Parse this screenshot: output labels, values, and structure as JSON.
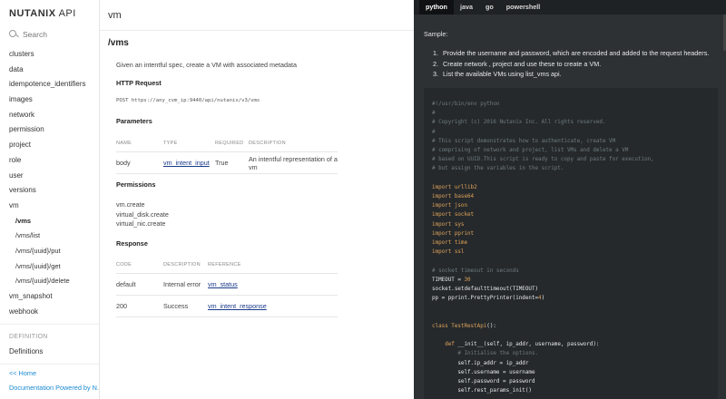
{
  "logo": {
    "brand": "NUTANIX",
    "api": "API"
  },
  "search": {
    "placeholder": "Search"
  },
  "sidebar": {
    "items": [
      {
        "label": "clusters"
      },
      {
        "label": "data"
      },
      {
        "label": "idempotence_identifiers"
      },
      {
        "label": "images"
      },
      {
        "label": "network"
      },
      {
        "label": "permission"
      },
      {
        "label": "project"
      },
      {
        "label": "role"
      },
      {
        "label": "user"
      },
      {
        "label": "versions"
      },
      {
        "label": "vm"
      }
    ],
    "vm_sub": [
      {
        "label": "/vms"
      },
      {
        "label": "/vms/list"
      },
      {
        "label": "/vms/{uuid}/put"
      },
      {
        "label": "/vms/{uuid}/get"
      },
      {
        "label": "/vms/{uuid}/delete"
      }
    ],
    "after_items": [
      {
        "label": "vm_snapshot"
      },
      {
        "label": "webhook"
      }
    ],
    "definition_header": "DEFINITION",
    "definitions_label": "Definitions",
    "home_link": "<< Home",
    "powered_by": "Documentation Powered by N..."
  },
  "content": {
    "title": "vm",
    "path": "/vms",
    "description": "Given an intentful spec, create a VM with associated metadata",
    "http_request_heading": "HTTP Request",
    "http_request_code": "POST https://any_cvm_ip:9440/api/nutanix/v3/vms",
    "parameters_heading": "Parameters",
    "param_headers": [
      "NAME",
      "TYPE",
      "REQUIRED",
      "DESCRIPTION"
    ],
    "params": [
      {
        "name": "body",
        "type": "vm_intent_input",
        "required": "True",
        "description": "An intentful representation of a vm"
      }
    ],
    "permissions_heading": "Permissions",
    "permissions": [
      "vm.create",
      "virtual_disk.create",
      "virtual_nic.create"
    ],
    "response_heading": "Response",
    "response_headers": [
      "CODE",
      "DESCRIPTION",
      "REFERENCE"
    ],
    "responses": [
      {
        "code": "default",
        "description": "Internal error",
        "reference": "vm_status"
      },
      {
        "code": "200",
        "description": "Success",
        "reference": "vm_intent_response"
      }
    ]
  },
  "code_panel": {
    "tabs": [
      "python",
      "java",
      "go",
      "powershell"
    ],
    "active_tab": "python",
    "sample_label": "Sample:",
    "steps": [
      "Provide the username and password, which are encoded and added to the request headers.",
      "Create network , project and use these to create a VM.",
      "List the available VMs using list_vms api."
    ],
    "code_lines": [
      {
        "t": "#!/usr/bin/env python",
        "c": "cmt"
      },
      {
        "t": "#",
        "c": "cmt"
      },
      {
        "t": "# Copyright (c) 2016 Nutanix Inc. All rights reserved.",
        "c": "cmt"
      },
      {
        "t": "#",
        "c": "cmt"
      },
      {
        "t": "# This script demonstrates how to authenticate, create VM",
        "c": "cmt"
      },
      {
        "t": "# comprising of network and project, list VMs and delete a VM",
        "c": "cmt"
      },
      {
        "t": "# based on UUID.This script is ready to copy and paste for execution,",
        "c": "cmt"
      },
      {
        "t": "# but assign the variables in the script.",
        "c": "cmt"
      },
      {
        "t": "",
        "c": ""
      },
      {
        "t": "import urllib2",
        "c": "imp"
      },
      {
        "t": "import base64",
        "c": "imp"
      },
      {
        "t": "import json",
        "c": "imp"
      },
      {
        "t": "import socket",
        "c": "imp"
      },
      {
        "t": "import sys",
        "c": "imp"
      },
      {
        "t": "import pprint",
        "c": "imp"
      },
      {
        "t": "import time",
        "c": "imp"
      },
      {
        "t": "import ssl",
        "c": "imp"
      },
      {
        "t": "",
        "c": ""
      },
      {
        "t": "# socket timeout in seconds",
        "c": "cmt"
      },
      {
        "t": "TIMEOUT = 30",
        "c": "num"
      },
      {
        "t": "socket.setdefaulttimeout(TIMEOUT)",
        "c": ""
      },
      {
        "t": "pp = pprint.PrettyPrinter(indent=4)",
        "c": "num2"
      },
      {
        "t": "",
        "c": ""
      },
      {
        "t": "",
        "c": ""
      },
      {
        "t": "class TestRestApi():",
        "c": "cls"
      },
      {
        "t": "",
        "c": ""
      },
      {
        "t": "    def __init__(self, ip_addr, username, password):",
        "c": "def"
      },
      {
        "t": "        # Initialise the options.",
        "c": "cmt"
      },
      {
        "t": "        self.ip_addr = ip_addr",
        "c": ""
      },
      {
        "t": "        self.username = username",
        "c": ""
      },
      {
        "t": "        self.password = password",
        "c": ""
      },
      {
        "t": "        self.rest_params_init()",
        "c": ""
      }
    ]
  }
}
